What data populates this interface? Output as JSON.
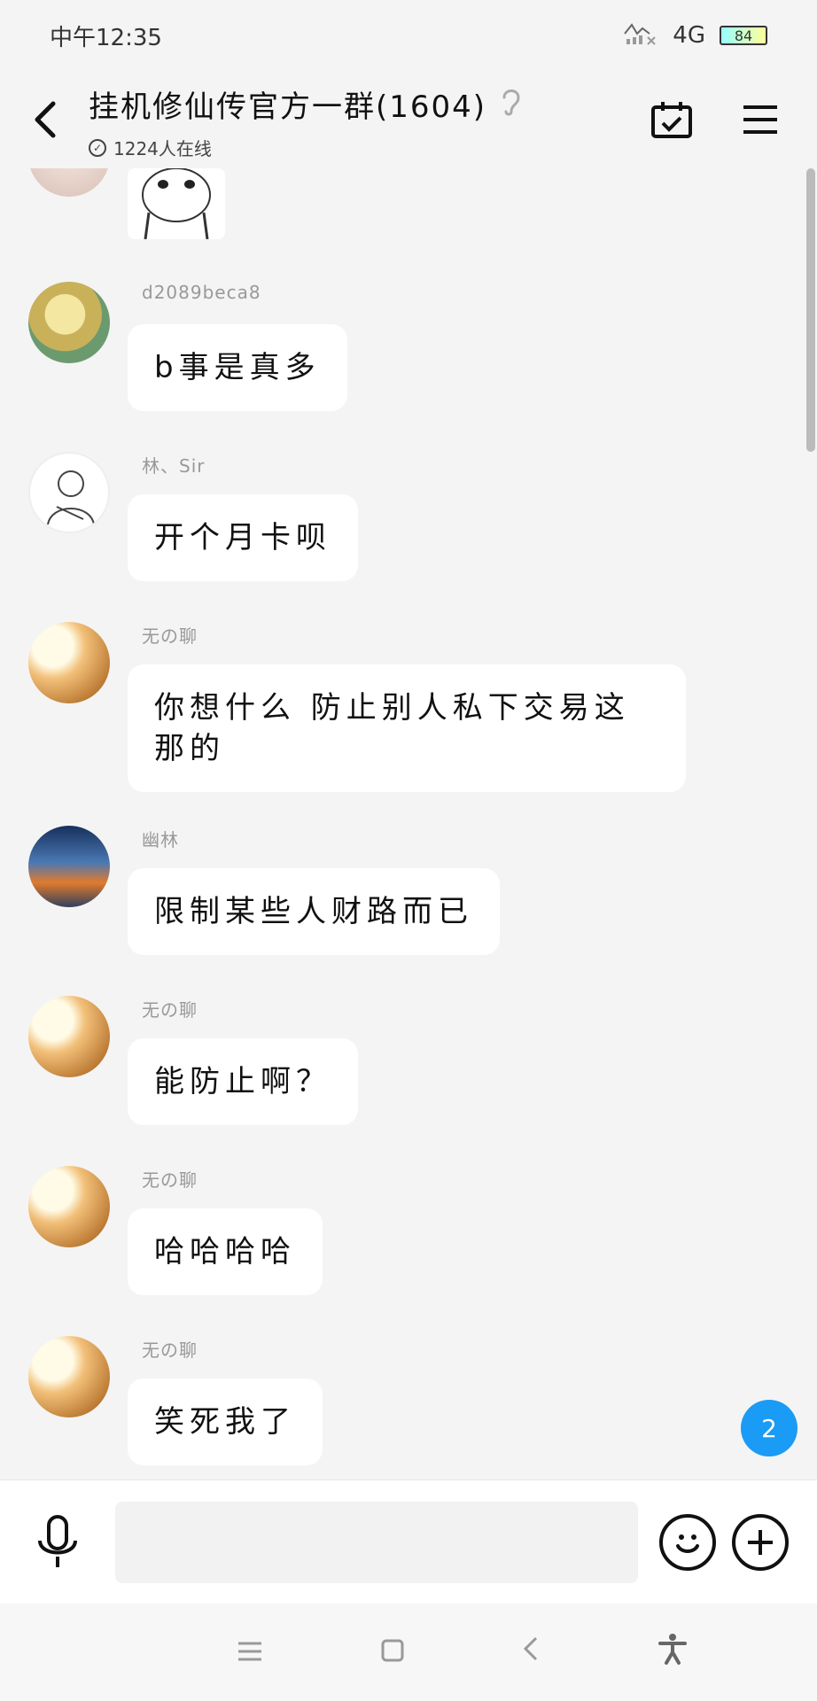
{
  "status_bar": {
    "time": "中午12:35",
    "network": "4G",
    "battery": "84"
  },
  "header": {
    "back": "‹",
    "title": "挂机修仙传官方一群(1604)",
    "online": "1224人在线"
  },
  "messages": [
    {
      "sender": "d2089beca8",
      "text": "b事是真多",
      "avatar": "blonde-warrior"
    },
    {
      "sender": "林、Sir",
      "text": "开个月卡呗",
      "avatar": "sketch"
    },
    {
      "sender": "无の聊",
      "text": "你想什么 防止别人私下交易这那的",
      "avatar": "sunlight"
    },
    {
      "sender": "幽林",
      "text": "限制某些人财路而已",
      "avatar": "night-camp"
    },
    {
      "sender": "无の聊",
      "text": "能防止啊？",
      "avatar": "sunlight"
    },
    {
      "sender": "无の聊",
      "text": "哈哈哈哈",
      "avatar": "sunlight"
    },
    {
      "sender": "无の聊",
      "text": "笑死我了",
      "avatar": "sunlight"
    }
  ],
  "unread_badge": "2",
  "input": {
    "value": ""
  },
  "colors": {
    "badge": "#1a9bf5",
    "background": "#f4f4f4",
    "bubble": "#ffffff"
  }
}
